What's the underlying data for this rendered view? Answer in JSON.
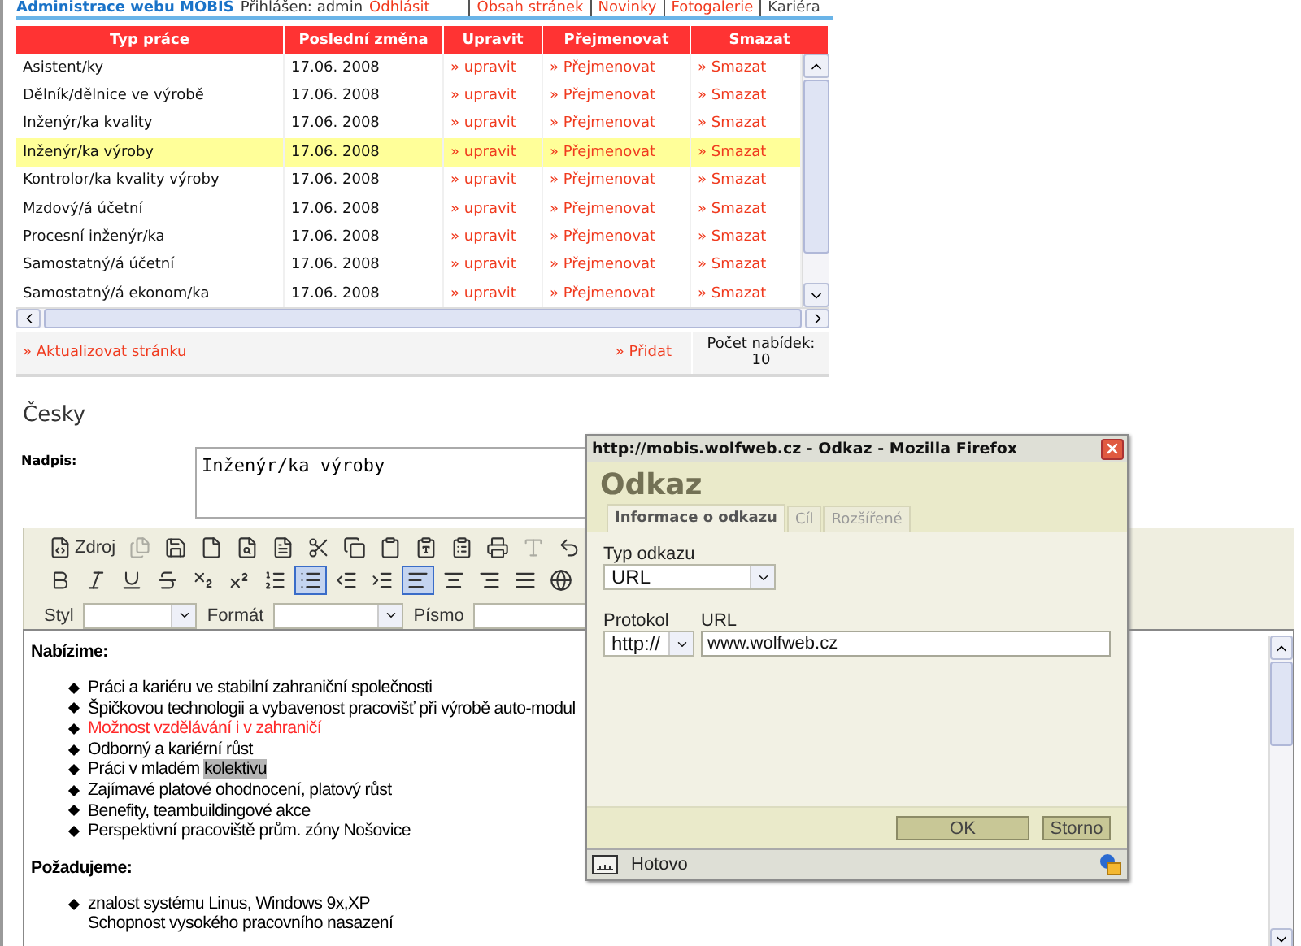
{
  "nav": {
    "title": "Administrace webu MOBIS",
    "user_label": "Přihlášen: admin",
    "logout": "Odhlásit",
    "links": [
      {
        "label": "Obsah stránek",
        "selected": false
      },
      {
        "label": "Novinky",
        "selected": false
      },
      {
        "label": "Fotogalerie",
        "selected": false
      },
      {
        "label": "Kariéra",
        "selected": true
      }
    ]
  },
  "table": {
    "columns": [
      "Typ práce",
      "Poslední změna",
      "Upravit",
      "Přejmenovat",
      "Smazat"
    ],
    "rows": [
      {
        "name": "Asistent/ky",
        "date": "17.06. 2008",
        "edit": "» upravit",
        "rename": "» Přejmenovat",
        "delete": "» Smazat",
        "selected": false
      },
      {
        "name": "Dělník/dělnice ve výrobě",
        "date": "17.06. 2008",
        "edit": "» upravit",
        "rename": "» Přejmenovat",
        "delete": "» Smazat",
        "selected": false
      },
      {
        "name": "Inženýr/ka kvality",
        "date": "17.06. 2008",
        "edit": "» upravit",
        "rename": "» Přejmenovat",
        "delete": "» Smazat",
        "selected": false
      },
      {
        "name": "Inženýr/ka výroby",
        "date": "17.06. 2008",
        "edit": "» upravit",
        "rename": "» Přejmenovat",
        "delete": "» Smazat",
        "selected": true
      },
      {
        "name": "Kontrolor/ka kvality výroby",
        "date": "17.06. 2008",
        "edit": "» upravit",
        "rename": "» Přejmenovat",
        "delete": "» Smazat",
        "selected": false
      },
      {
        "name": "Mzdový/á účetní",
        "date": "17.06. 2008",
        "edit": "» upravit",
        "rename": "» Přejmenovat",
        "delete": "» Smazat",
        "selected": false
      },
      {
        "name": "Procesní inženýr/ka",
        "date": "17.06. 2008",
        "edit": "» upravit",
        "rename": "» Přejmenovat",
        "delete": "» Smazat",
        "selected": false
      },
      {
        "name": "Samostatný/á účetní",
        "date": "17.06. 2008",
        "edit": "» upravit",
        "rename": "» Přejmenovat",
        "delete": "» Smazat",
        "selected": false
      },
      {
        "name": "Samostatný/á ekonom/ka",
        "date": "17.06. 2008",
        "edit": "» upravit",
        "rename": "» Přejmenovat",
        "delete": "» Smazat",
        "selected": false
      }
    ],
    "footer": {
      "refresh": "» Aktualizovat stránku",
      "add": "» Přidat",
      "count_label": "Počet nabídek:",
      "count": "10"
    }
  },
  "language": "Česky",
  "title_field": {
    "label": "Nadpis:",
    "value": "Inženýr/ka výroby"
  },
  "editor": {
    "toolbar": {
      "rows": [
        [
          {
            "kind": "source",
            "label": "Zdroj",
            "selected": false,
            "disabled": false
          },
          {
            "kind": "properties",
            "selected": false,
            "disabled": true
          },
          {
            "kind": "save",
            "selected": false,
            "disabled": false
          },
          {
            "kind": "new-page",
            "selected": false,
            "disabled": false
          },
          {
            "kind": "preview",
            "selected": false,
            "disabled": false
          },
          {
            "kind": "templates",
            "selected": false,
            "disabled": false
          },
          {
            "kind": "cut",
            "selected": false,
            "disabled": false
          },
          {
            "kind": "copy",
            "selected": false,
            "disabled": false
          },
          {
            "kind": "paste",
            "selected": false,
            "disabled": false
          },
          {
            "kind": "paste-text",
            "selected": false,
            "disabled": false
          },
          {
            "kind": "paste-word",
            "selected": false,
            "disabled": false
          },
          {
            "kind": "print",
            "selected": false,
            "disabled": false
          },
          {
            "kind": "spellcheck",
            "selected": false,
            "disabled": true
          },
          {
            "kind": "undo",
            "selected": false,
            "disabled": false
          }
        ],
        [
          {
            "kind": "bold",
            "selected": false,
            "disabled": false
          },
          {
            "kind": "italic",
            "selected": false,
            "disabled": false
          },
          {
            "kind": "underline",
            "selected": false,
            "disabled": false
          },
          {
            "kind": "strike",
            "selected": false,
            "disabled": false
          },
          {
            "kind": "subscript",
            "selected": false,
            "disabled": false
          },
          {
            "kind": "superscript",
            "selected": false,
            "disabled": false
          },
          {
            "kind": "ordered-list",
            "selected": false,
            "disabled": false
          },
          {
            "kind": "bullet-list",
            "selected": true,
            "disabled": false
          },
          {
            "kind": "outdent",
            "selected": false,
            "disabled": false
          },
          {
            "kind": "indent",
            "selected": false,
            "disabled": false
          },
          {
            "kind": "align-left",
            "selected": true,
            "disabled": false
          },
          {
            "kind": "align-center",
            "selected": false,
            "disabled": false
          },
          {
            "kind": "align-right",
            "selected": false,
            "disabled": false
          },
          {
            "kind": "justify",
            "selected": false,
            "disabled": false
          },
          {
            "kind": "link",
            "selected": false,
            "disabled": false
          }
        ]
      ],
      "selects": [
        {
          "label": "Styl"
        },
        {
          "label": "Formát"
        },
        {
          "label": "Písmo"
        }
      ]
    },
    "content": [
      {
        "kind": "heading",
        "text": "Nabízime:"
      },
      {
        "kind": "list",
        "items": [
          {
            "text": "Práci a kariéru ve stabilní zahraniční společnosti",
            "color": "#000000",
            "bullet": true
          },
          {
            "text": "Špičkovou technologii a vybavenost pracovišť při výrobě auto-modul",
            "color": "#000000",
            "bullet": true
          },
          {
            "text": "Možnost vzdělávání i v zahraničí",
            "color": "#ff2a2a",
            "bullet": true
          },
          {
            "text": "Odborný a kariérní růst",
            "color": "#000000",
            "bullet": true
          },
          {
            "text": "Práci v mladém",
            "selected_text": "kolektivu",
            "color": "#000000",
            "bullet": true
          },
          {
            "text": "Zajímavé platové ohodnocení, platový růst",
            "color": "#000000",
            "bullet": true
          },
          {
            "text": "Benefity, teambuildingové akce",
            "color": "#000000",
            "bullet": true
          },
          {
            "text": "Perspektivní pracoviště prům. zóny Nošovice",
            "color": "#000000",
            "bullet": true
          }
        ]
      },
      {
        "kind": "heading",
        "text": "Požadujeme:"
      },
      {
        "kind": "list",
        "items": [
          {
            "text": "znalost systému Linus, Windows 9x,XP",
            "color": "#000000",
            "bullet": true
          },
          {
            "text": "Schopnost vysokého pracovního nasazení",
            "color": "#000000",
            "bullet": false
          }
        ]
      }
    ]
  },
  "dialog": {
    "window_title": "http://mobis.wolfweb.cz - Odkaz - Mozilla Firefox",
    "heading": "Odkaz",
    "tabs": [
      {
        "label": "Informace o odkazu",
        "selected": true
      },
      {
        "label": "Cíl",
        "selected": false
      },
      {
        "label": "Rozšířené",
        "selected": false
      }
    ],
    "link_type": {
      "label": "Typ odkazu",
      "value": "URL"
    },
    "protocol": {
      "label": "Protokol",
      "value": "http://"
    },
    "url": {
      "label": "URL",
      "value": "www.wolfweb.cz"
    },
    "buttons": [
      {
        "label": "OK",
        "kind": "primary"
      },
      {
        "label": "Storno",
        "kind": "secondary"
      }
    ],
    "status": "Hotovo"
  }
}
